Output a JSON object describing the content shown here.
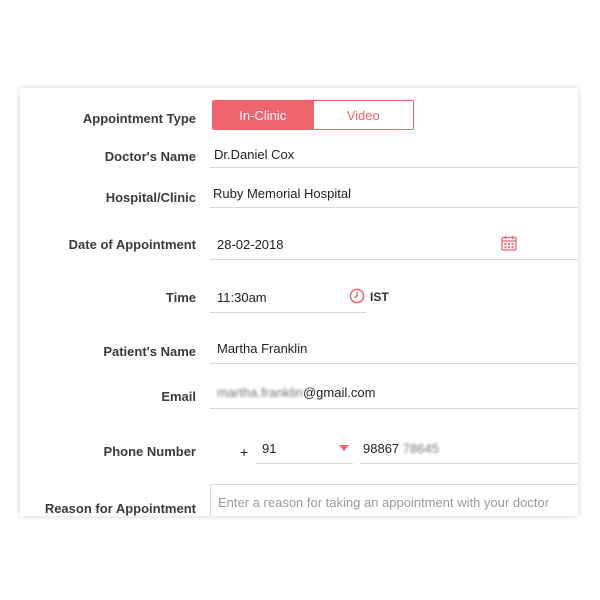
{
  "form": {
    "appointment_type": {
      "label": "Appointment Type",
      "options": [
        "In-Clinic",
        "Video"
      ],
      "selected": "In-Clinic"
    },
    "doctor": {
      "label": "Doctor's Name",
      "value": "Dr.Daniel Cox"
    },
    "hospital": {
      "label": "Hospital/Clinic",
      "value": "Ruby Memorial Hospital"
    },
    "date": {
      "label": "Date of Appointment",
      "value": "28-02-2018",
      "icon": "calendar-icon"
    },
    "time": {
      "label": "Time",
      "value": "11:30am",
      "icon": "clock-icon",
      "timezone": "IST"
    },
    "patient": {
      "label": "Patient's Name",
      "value": "Martha Franklin"
    },
    "email": {
      "label": "Email",
      "value_blurred": "martha.franklin",
      "domain": "@gmail.com"
    },
    "phone": {
      "label": "Phone Number",
      "plus": "+",
      "country_code": "91",
      "number_visible": "98867",
      "number_blurred": "78645"
    },
    "reason": {
      "label": "Reason for Appointment",
      "placeholder": "Enter a reason for taking an appointment with your doctor"
    }
  },
  "colors": {
    "accent": "#f0646e",
    "divider": "#d9d9d9"
  }
}
